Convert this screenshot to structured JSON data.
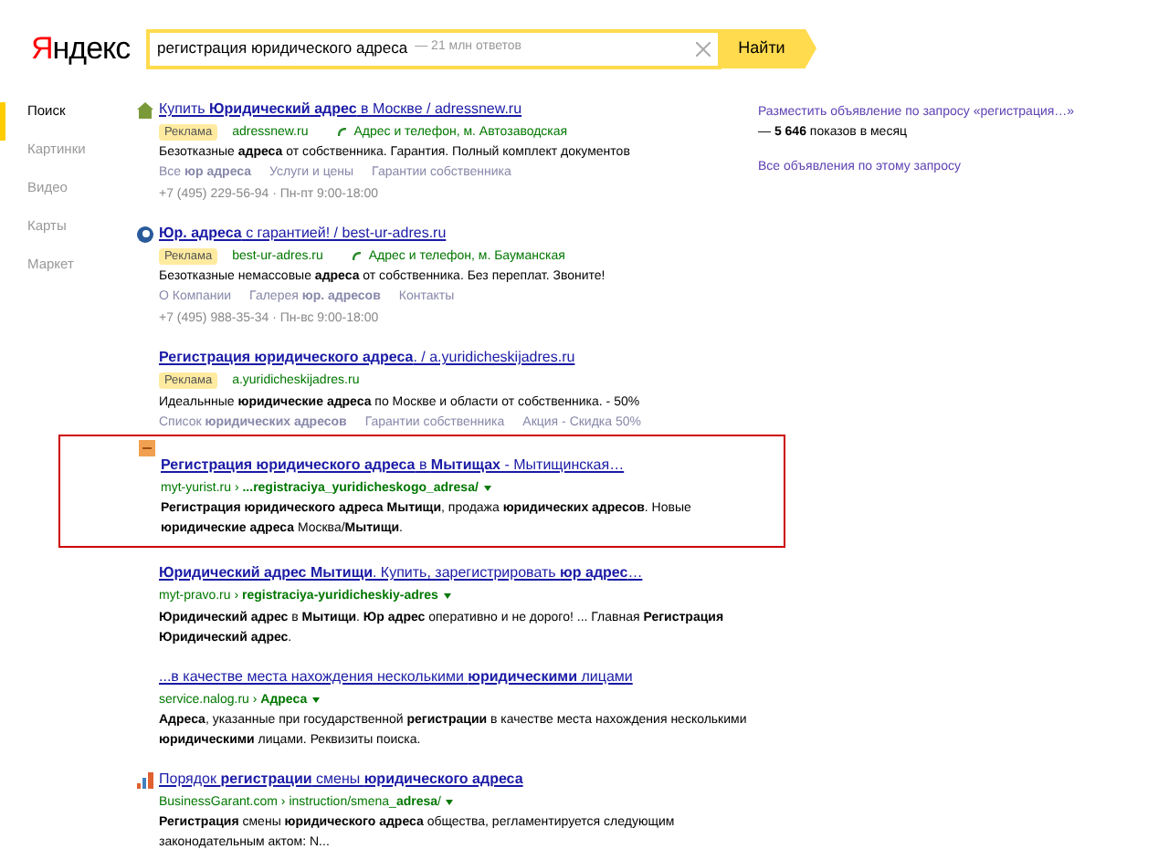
{
  "logo": "Яндекс",
  "search": {
    "value": "регистрация юридического адреса",
    "hint": "— 21 млн ответов",
    "button": "Найти"
  },
  "sidebar": {
    "items": [
      {
        "label": "Поиск",
        "selected": true
      },
      {
        "label": "Картинки",
        "selected": false
      },
      {
        "label": "Видео",
        "selected": false
      },
      {
        "label": "Карты",
        "selected": false
      },
      {
        "label": "Маркет",
        "selected": false
      }
    ]
  },
  "results": [
    {
      "kind": "ad",
      "favicon": true,
      "highlighted": false,
      "title": "Купить **Юридический адрес** в Москве / adressnew.ru",
      "ad_label": "Реклама",
      "domain": "adressnew.ru",
      "contact": "Адрес и телефон, м. Автозаводская",
      "snippet": "Безотказные **адреса** от собственника. Гарантия. Полный комплект документов",
      "sitelinks": [
        "Все **юр адреса**",
        "Услуги и цены",
        "Гарантии собственника"
      ],
      "phone": "+7 (495) 229-56-94 · Пн-пт 9:00-18:00"
    },
    {
      "kind": "ad",
      "favicon": true,
      "highlighted": false,
      "title": "**Юр. адреса** с гарантией! / best-ur-adres.ru",
      "ad_label": "Реклама",
      "domain": "best-ur-adres.ru",
      "contact": "Адрес и телефон, м. Бауманская",
      "snippet": "Безотказные немассовые **адреса** от собственника. Без переплат. Звоните!",
      "sitelinks": [
        "О Компании",
        "Галерея **юр. адресов**",
        "Контакты"
      ],
      "phone": "+7 (495) 988-35-34 · Пн-вс 9:00-18:00"
    },
    {
      "kind": "ad",
      "favicon": false,
      "highlighted": false,
      "title": "**Регистрация юридического адреса**. / a.yuridicheskijadres.ru",
      "ad_label": "Реклама",
      "domain": "a.yuridicheskijadres.ru",
      "snippet": "Идеальнные **юридические адреса** по Москве и области от собственника. - 50%",
      "sitelinks": [
        "Список **юридических адресов**",
        "Гарантии собственника",
        "Акция - Скидка 50%"
      ]
    },
    {
      "kind": "organic",
      "favicon": true,
      "highlighted": true,
      "title": "**Регистрация юридического адреса** в **Мытищах** - Мытищинская…",
      "url": "myt-yurist.ru › **...registraciya_yuridicheskogo_adresa/**",
      "snippet": "**Регистрация юридического адреса Мытищи**, продажа **юридических адресов**. Новые **юридические адреса** Москва/**Мытищи**."
    },
    {
      "kind": "organic",
      "favicon": false,
      "highlighted": false,
      "title": "**Юридический адрес Мытищи**. Купить, зарегистрировать **юр адрес**…",
      "url": "myt-pravo.ru › **registraciya-yuridicheskiy-adres**",
      "snippet": "**Юридический адрес** в **Мытищи**. **Юр адрес** оперативно и не дорого! ... Главная **Регистрация Юридический адрес**."
    },
    {
      "kind": "organic",
      "favicon": false,
      "highlighted": false,
      "title": "...в качестве места нахождения несколькими **юридическими** лицами",
      "url": "service.nalog.ru › **Адреса**",
      "snippet": "**Адреса**, указанные при государственной **регистрации** в качестве места нахождения несколькими **юридическими** лицами. Реквизиты поиска."
    },
    {
      "kind": "organic",
      "favicon": true,
      "highlighted": false,
      "title": "Порядок **регистрации** смены **юридического адреса**",
      "url": "BusinessGarant.com › instruction/smena_**adresa**/",
      "snippet": "**Регистрация** смены **юридического адреса** общества, регламентируется следующим законодательным актом: N..."
    }
  ],
  "aside": {
    "offer_link": "Разместить объявление по запросу «регистрация…»",
    "offer_text": "— **5 646** показов в месяц",
    "all_ads_link": "Все объявления по этому запросу"
  }
}
